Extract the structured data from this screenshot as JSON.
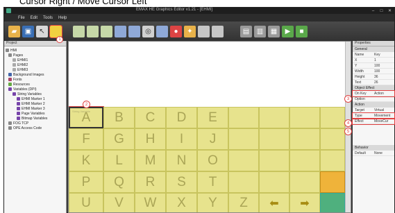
{
  "caption": "Cursor Right  /  Move Cursor Left",
  "window": {
    "title": "EMAX HE Graphics Editor v1.21 - [EHMI]"
  },
  "menu": [
    "File",
    "Edit",
    "Tools",
    "Help"
  ],
  "toolbar": {
    "badge": "1",
    "icons": [
      "app-folder-icon",
      "save-icon",
      "cursor-icon",
      "selected-shape-icon",
      "line-icon",
      "rect-icon",
      "ellipse-icon",
      "image-icon",
      "grid-icon",
      "picture-icon",
      "record-icon",
      "star-icon",
      "panel-icon",
      "chart-icon",
      "settings-icon",
      "align-icon",
      "layers-icon",
      "export-icon",
      "run-icon"
    ]
  },
  "tree": {
    "header": "Project",
    "nodes": [
      "HMI",
      "Pages",
      "EHMI1",
      "EHMI2",
      "EHMI3",
      "Background Images",
      "Fonts",
      "Resources",
      "Variables (DPI)",
      "String Variables",
      "EHMI Marker 1",
      "EHMI Marker 2",
      "EHMI Marker 3",
      "Page Variables",
      "Bitmap Variables",
      "FOG TCP",
      "OPE Access Code"
    ]
  },
  "keyboard": {
    "badge": "2",
    "rows": [
      [
        "A",
        "B",
        "C",
        "D",
        "E",
        "",
        "",
        "",
        ""
      ],
      [
        "F",
        "G",
        "H",
        "I",
        "J",
        "",
        "",
        "",
        ""
      ],
      [
        "K",
        "L",
        "M",
        "N",
        "O",
        "",
        "",
        "",
        ""
      ],
      [
        "P",
        "Q",
        "R",
        "S",
        "T",
        "",
        "",
        "",
        ""
      ],
      [
        "U",
        "V",
        "W",
        "X",
        "Y",
        "Z",
        "",
        "",
        ""
      ]
    ],
    "arrow_left": "⬅",
    "arrow_right": "➡"
  },
  "properties": {
    "header": "Properties",
    "groups": [
      {
        "name": "General",
        "rows": [
          [
            "Name",
            "Key"
          ],
          [
            "X",
            "1"
          ],
          [
            "Y",
            "100"
          ],
          [
            "Width",
            "100"
          ],
          [
            "Height",
            "36"
          ],
          [
            "Text",
            "26"
          ]
        ]
      },
      {
        "name": "Object Effect",
        "rows": [
          [
            "On Key",
            "Action"
          ],
          [
            "Option",
            ""
          ]
        ]
      },
      {
        "name": "Action",
        "rows": [
          [
            "Target",
            "Virtual"
          ],
          [
            "Type",
            "Movement"
          ],
          [
            "Effect",
            "MoveCur"
          ]
        ]
      },
      {
        "name": "Behavior",
        "rows": [
          [
            "Default",
            "None"
          ]
        ]
      }
    ],
    "badges": [
      "3",
      "4",
      "5"
    ]
  }
}
